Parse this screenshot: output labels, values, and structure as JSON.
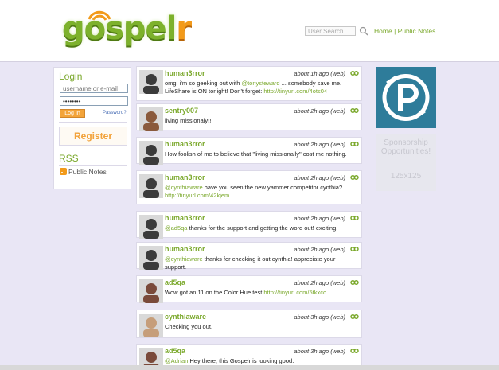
{
  "brand": {
    "logo_text": "gospel",
    "logo_accent": "r",
    "color_green": "#7aa82b",
    "color_orange": "#f29a1a"
  },
  "header": {
    "search_placeholder": "User Search...",
    "links": [
      "Home",
      "Public Notes"
    ],
    "separator": "|"
  },
  "sidebar": {
    "login_title": "Login",
    "username_placeholder": "username or e-mail",
    "password_value": "••••••••",
    "login_button": "Log In",
    "forgot_link": "Password?",
    "register_button": "Register",
    "rss_title": "RSS",
    "public_notes_link": "Public Notes"
  },
  "feed": {
    "items": [
      {
        "user": "human3rror",
        "meta": "about 1h ago (web)",
        "segments": [
          "omg. i'm so geeking out with ",
          "@tonysteward",
          " ... somebody save me. LifeShare is ON tonight! Don't forget: ",
          "http://tinyurl.com/4ots04"
        ]
      },
      {
        "user": "sentry007",
        "meta": "about 2h ago (web)",
        "segments": [
          "living missionaly!!!"
        ]
      },
      {
        "user": "human3rror",
        "meta": "about 2h ago (web)",
        "segments": [
          "How foolish of me to believe that \"living missionally\" cost me nothing."
        ]
      },
      {
        "user": "human3rror",
        "meta": "about 2h ago (web)",
        "segments": [
          "",
          "@cynthiaware",
          " have you seen the new yammer competitor cynthia? ",
          "http://tinyurl.com/42kjem"
        ]
      },
      {
        "user": "human3rror",
        "meta": "about 2h ago (web)",
        "segments": [
          "",
          "@ad5qa",
          " thanks for the support and getting the word out! exciting."
        ]
      },
      {
        "user": "human3rror",
        "meta": "about 2h ago (web)",
        "segments": [
          "",
          "@cynthiaware",
          " thanks for checking it out cynthia! appreciate your support."
        ]
      },
      {
        "user": "ad5qa",
        "meta": "about 2h ago (web)",
        "segments": [
          "Wow got an 11 on the Color Hue test ",
          "http://tinyurl.com/5tkxcc"
        ]
      },
      {
        "user": "cynthiaware",
        "meta": "about 3h ago (web)",
        "segments": [
          "Checking you out."
        ]
      },
      {
        "user": "ad5qa",
        "meta": "about 3h ago (web)",
        "segments": [
          "",
          "@Adrian",
          " Hey there, this Gospelr is looking good."
        ]
      }
    ]
  },
  "ads": {
    "sponsor_line1": "Sponsorship",
    "sponsor_line2": "Opportunities!",
    "sponsor_size": "125x125"
  }
}
